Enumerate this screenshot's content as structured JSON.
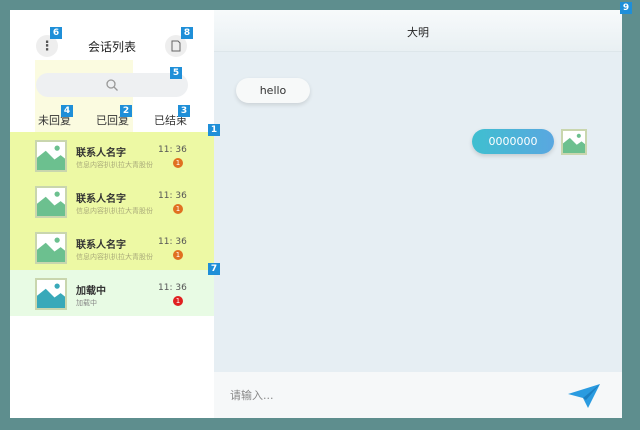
{
  "sidebar": {
    "title": "会话列表",
    "menu_icon": "⋮",
    "tabs": [
      "未回复",
      "已回复",
      "已结束"
    ],
    "items": [
      {
        "name": "联系人名字",
        "msg": "信息内容扒扒拉大青股份",
        "time": "11: 36",
        "badge": "1"
      },
      {
        "name": "联系人名字",
        "msg": "信息内容扒扒拉大青股份",
        "time": "11: 36",
        "badge": "1"
      },
      {
        "name": "联系人名字",
        "msg": "信息内容扒扒拉大青股份",
        "time": "11: 36",
        "badge": "1"
      }
    ],
    "loading_item": {
      "name": "加载中",
      "msg": "加载中",
      "time": "11: 36",
      "badge": "1"
    }
  },
  "chat": {
    "title": "大明",
    "messages": [
      {
        "side": "left",
        "text": "hello"
      },
      {
        "side": "right",
        "text": "0000000"
      }
    ],
    "input_placeholder": "请输入..."
  },
  "annotations": [
    "1",
    "2",
    "3",
    "4",
    "5",
    "6",
    "7",
    "8",
    "9"
  ],
  "colors": {
    "background": "#5e8e8e",
    "list_highlight": "#edf9a4",
    "loading_highlight": "#e8fbe4",
    "accent": "#1f8fd8",
    "bubble_gradient_start": "#3fbfd0",
    "bubble_gradient_end": "#5aa7e0"
  },
  "icons": {
    "menu": "more-vertical-icon",
    "document": "document-icon",
    "search": "search-icon",
    "avatar": "image-placeholder-icon",
    "send": "send-icon"
  }
}
